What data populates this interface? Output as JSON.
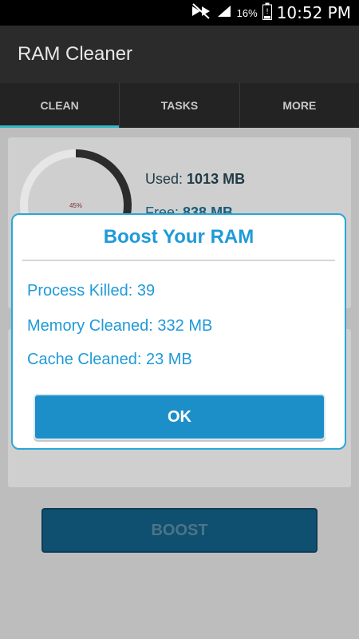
{
  "status_bar": {
    "battery_percent": "16%",
    "time": "10:52 PM",
    "icons": [
      "mute-icon",
      "signal-icon",
      "battery-icon"
    ]
  },
  "app": {
    "title": "RAM Cleaner"
  },
  "tabs": [
    {
      "label": "CLEAN",
      "active": true
    },
    {
      "label": "TASKS",
      "active": false
    },
    {
      "label": "MORE",
      "active": false
    }
  ],
  "memory": {
    "gauge_percent": "45%",
    "used_label": "Used:",
    "used_value": "1013 MB",
    "free_label": "Free:",
    "free_value": "838 MB"
  },
  "boost_button": {
    "label": "BOOST"
  },
  "dialog": {
    "title": "Boost Your RAM",
    "lines": [
      "Process Killed: 39",
      "Memory Cleaned: 332 MB",
      "Cache Cleaned: 23 MB"
    ],
    "ok_label": "OK"
  },
  "colors": {
    "accent": "#1f9ad8",
    "tab_indicator": "#35b8c4",
    "boost_bg": "#0f4f70"
  }
}
